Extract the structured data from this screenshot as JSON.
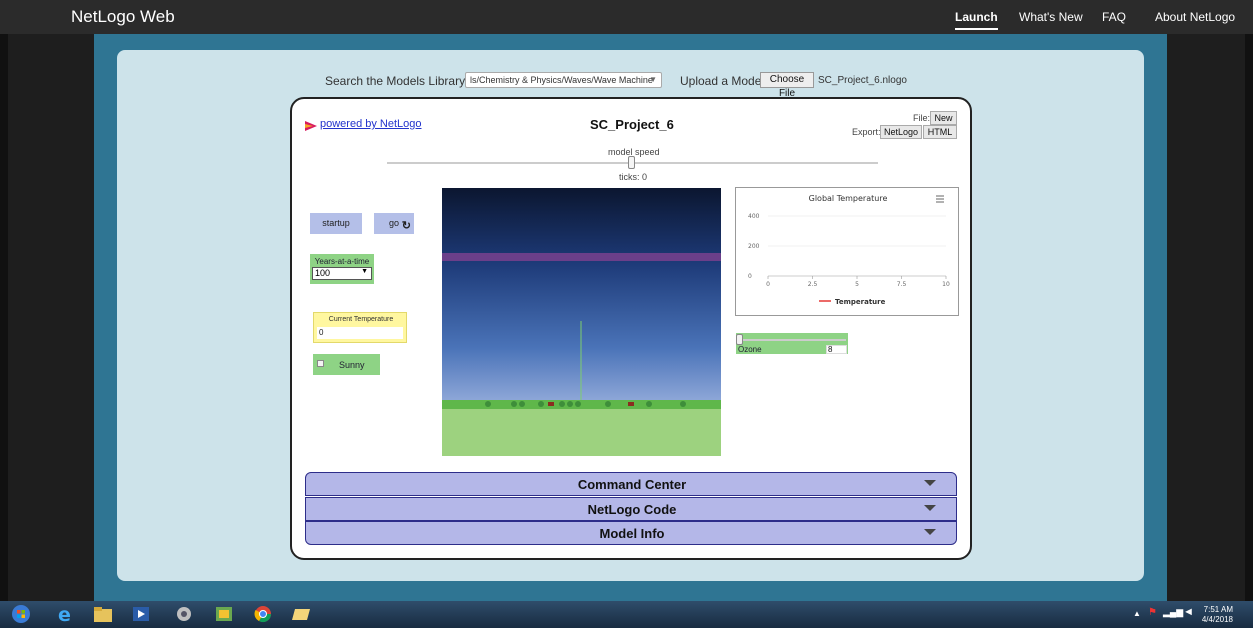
{
  "nav": {
    "brand": "NetLogo Web",
    "items": [
      "Launch",
      "What's New",
      "FAQ",
      "About NetLogo"
    ]
  },
  "library": {
    "search_label": "Search the Models Library:",
    "selected_model": "ls/Chemistry & Physics/Waves/Wave Machine",
    "upload_label": "Upload a Model:",
    "choose_file_label": "Choose File",
    "file_name": "SC_Project_6.nlogo"
  },
  "model": {
    "powered_by": "powered by NetLogo",
    "title": "SC_Project_6",
    "file_label": "File:",
    "new_label": "New",
    "export_label": "Export:",
    "export_netlogo": "NetLogo",
    "export_html": "HTML",
    "speed_label": "model speed",
    "ticks_label": "ticks: 0"
  },
  "widgets": {
    "startup_label": "startup",
    "go_label": "go",
    "go_forever_icon": "refresh-icon",
    "years_label": "Years-at-a-time",
    "years_value": "100",
    "temp_label": "Current Temperature",
    "temp_value": "0",
    "sunny_label": "Sunny",
    "sunny_checked": false,
    "ozone_label": "Ozone",
    "ozone_value": "8"
  },
  "plot": {
    "title": "Global Temperature",
    "menu_icon": "hamburger-menu-icon",
    "y_ticks": [
      "400",
      "200",
      "0"
    ],
    "x_ticks": [
      "0",
      "2.5",
      "5",
      "7.5",
      "10"
    ],
    "legend": "Temperature",
    "series_color": "#e53935"
  },
  "accordions": {
    "command_center": "Command Center",
    "netlogo_code": "NetLogo Code",
    "model_info": "Model Info"
  },
  "taskbar": {
    "time": "7:51 AM",
    "date": "4/4/2018"
  },
  "colors": {
    "page_bg": "#2f7593",
    "panel_bg": "#cde3ea",
    "button_blue": "#b4bfe8",
    "widget_green": "#8ed385",
    "monitor_yellow": "#fff7a0",
    "accordion": "#b4b7e8"
  }
}
